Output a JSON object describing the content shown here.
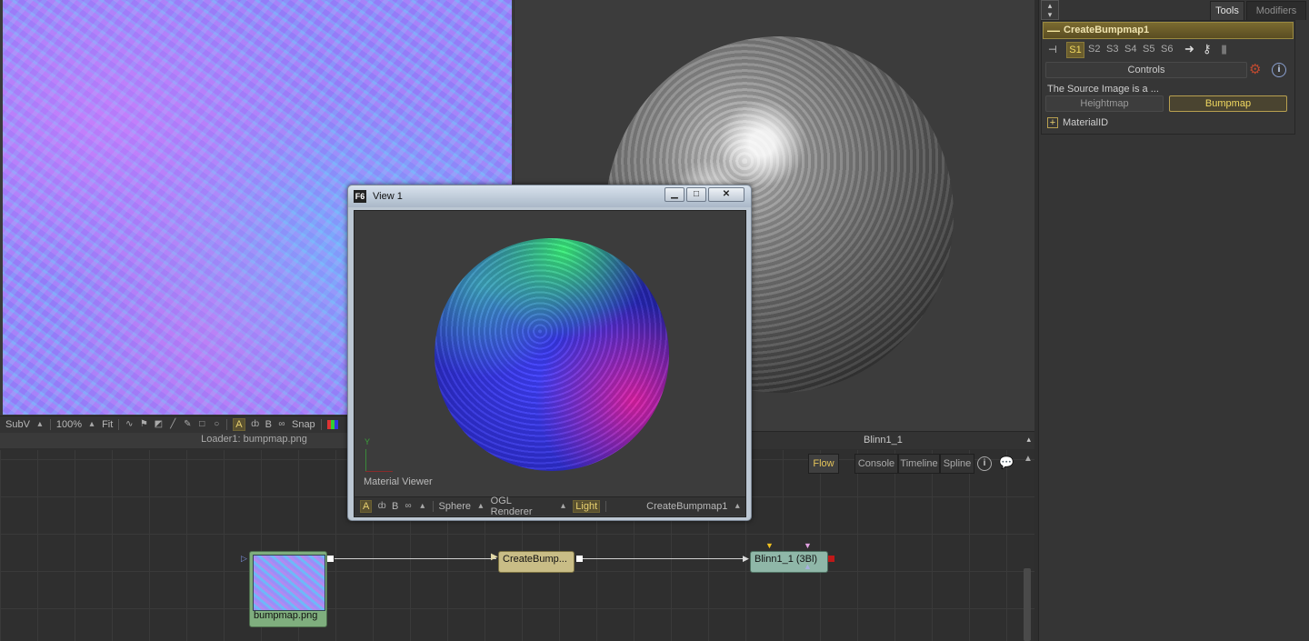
{
  "left_viewer": {
    "toolbar": {
      "subv": "SubV",
      "zoom": "100%",
      "fit": "Fit",
      "a": "A",
      "b": "B",
      "snap": "Snap"
    },
    "caption": "Loader1: bumpmap.png"
  },
  "right_viewer": {
    "caption": "Blinn1_1"
  },
  "tools_panel": {
    "tabs": [
      "Tools",
      "Modifiers"
    ],
    "tool_name": "CreateBumpmap1",
    "slots": [
      "S1",
      "S2",
      "S3",
      "S4",
      "S5",
      "S6"
    ],
    "controls_label": "Controls",
    "source_label": "The Source Image is a ...",
    "option_heightmap": "Heightmap",
    "option_bumpmap": "Bumpmap",
    "material_id": "MaterialID"
  },
  "flow": {
    "tabs": [
      "Flow",
      "Console",
      "Timeline",
      "Spline"
    ],
    "nodes": {
      "loader": "bumpmap.png",
      "create_bump": "CreateBump...",
      "blinn": "Blinn1_1  (3Bl)"
    }
  },
  "view1": {
    "title": "View 1",
    "app_badge": "F6",
    "axis_y": "Y",
    "caption": "Material Viewer",
    "toolbar": {
      "a": "A",
      "b": "B",
      "sphere": "Sphere",
      "renderer": "OGL Renderer",
      "light": "Light",
      "tool": "CreateBumpmap1"
    }
  }
}
